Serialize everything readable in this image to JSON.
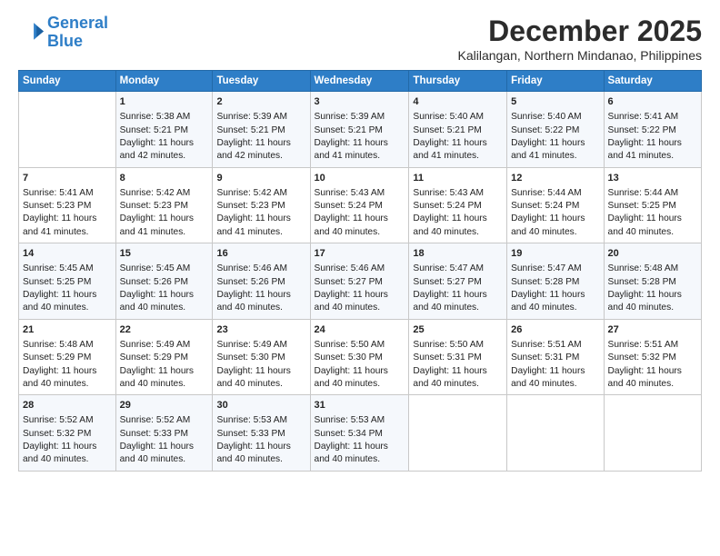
{
  "logo": {
    "line1": "General",
    "line2": "Blue"
  },
  "title": "December 2025",
  "location": "Kalilangan, Northern Mindanao, Philippines",
  "days_header": [
    "Sunday",
    "Monday",
    "Tuesday",
    "Wednesday",
    "Thursday",
    "Friday",
    "Saturday"
  ],
  "weeks": [
    [
      {
        "day": "",
        "sunrise": "",
        "sunset": "",
        "daylight": ""
      },
      {
        "day": "1",
        "sunrise": "Sunrise: 5:38 AM",
        "sunset": "Sunset: 5:21 PM",
        "daylight": "Daylight: 11 hours and 42 minutes."
      },
      {
        "day": "2",
        "sunrise": "Sunrise: 5:39 AM",
        "sunset": "Sunset: 5:21 PM",
        "daylight": "Daylight: 11 hours and 42 minutes."
      },
      {
        "day": "3",
        "sunrise": "Sunrise: 5:39 AM",
        "sunset": "Sunset: 5:21 PM",
        "daylight": "Daylight: 11 hours and 41 minutes."
      },
      {
        "day": "4",
        "sunrise": "Sunrise: 5:40 AM",
        "sunset": "Sunset: 5:21 PM",
        "daylight": "Daylight: 11 hours and 41 minutes."
      },
      {
        "day": "5",
        "sunrise": "Sunrise: 5:40 AM",
        "sunset": "Sunset: 5:22 PM",
        "daylight": "Daylight: 11 hours and 41 minutes."
      },
      {
        "day": "6",
        "sunrise": "Sunrise: 5:41 AM",
        "sunset": "Sunset: 5:22 PM",
        "daylight": "Daylight: 11 hours and 41 minutes."
      }
    ],
    [
      {
        "day": "7",
        "sunrise": "Sunrise: 5:41 AM",
        "sunset": "Sunset: 5:23 PM",
        "daylight": "Daylight: 11 hours and 41 minutes."
      },
      {
        "day": "8",
        "sunrise": "Sunrise: 5:42 AM",
        "sunset": "Sunset: 5:23 PM",
        "daylight": "Daylight: 11 hours and 41 minutes."
      },
      {
        "day": "9",
        "sunrise": "Sunrise: 5:42 AM",
        "sunset": "Sunset: 5:23 PM",
        "daylight": "Daylight: 11 hours and 41 minutes."
      },
      {
        "day": "10",
        "sunrise": "Sunrise: 5:43 AM",
        "sunset": "Sunset: 5:24 PM",
        "daylight": "Daylight: 11 hours and 40 minutes."
      },
      {
        "day": "11",
        "sunrise": "Sunrise: 5:43 AM",
        "sunset": "Sunset: 5:24 PM",
        "daylight": "Daylight: 11 hours and 40 minutes."
      },
      {
        "day": "12",
        "sunrise": "Sunrise: 5:44 AM",
        "sunset": "Sunset: 5:24 PM",
        "daylight": "Daylight: 11 hours and 40 minutes."
      },
      {
        "day": "13",
        "sunrise": "Sunrise: 5:44 AM",
        "sunset": "Sunset: 5:25 PM",
        "daylight": "Daylight: 11 hours and 40 minutes."
      }
    ],
    [
      {
        "day": "14",
        "sunrise": "Sunrise: 5:45 AM",
        "sunset": "Sunset: 5:25 PM",
        "daylight": "Daylight: 11 hours and 40 minutes."
      },
      {
        "day": "15",
        "sunrise": "Sunrise: 5:45 AM",
        "sunset": "Sunset: 5:26 PM",
        "daylight": "Daylight: 11 hours and 40 minutes."
      },
      {
        "day": "16",
        "sunrise": "Sunrise: 5:46 AM",
        "sunset": "Sunset: 5:26 PM",
        "daylight": "Daylight: 11 hours and 40 minutes."
      },
      {
        "day": "17",
        "sunrise": "Sunrise: 5:46 AM",
        "sunset": "Sunset: 5:27 PM",
        "daylight": "Daylight: 11 hours and 40 minutes."
      },
      {
        "day": "18",
        "sunrise": "Sunrise: 5:47 AM",
        "sunset": "Sunset: 5:27 PM",
        "daylight": "Daylight: 11 hours and 40 minutes."
      },
      {
        "day": "19",
        "sunrise": "Sunrise: 5:47 AM",
        "sunset": "Sunset: 5:28 PM",
        "daylight": "Daylight: 11 hours and 40 minutes."
      },
      {
        "day": "20",
        "sunrise": "Sunrise: 5:48 AM",
        "sunset": "Sunset: 5:28 PM",
        "daylight": "Daylight: 11 hours and 40 minutes."
      }
    ],
    [
      {
        "day": "21",
        "sunrise": "Sunrise: 5:48 AM",
        "sunset": "Sunset: 5:29 PM",
        "daylight": "Daylight: 11 hours and 40 minutes."
      },
      {
        "day": "22",
        "sunrise": "Sunrise: 5:49 AM",
        "sunset": "Sunset: 5:29 PM",
        "daylight": "Daylight: 11 hours and 40 minutes."
      },
      {
        "day": "23",
        "sunrise": "Sunrise: 5:49 AM",
        "sunset": "Sunset: 5:30 PM",
        "daylight": "Daylight: 11 hours and 40 minutes."
      },
      {
        "day": "24",
        "sunrise": "Sunrise: 5:50 AM",
        "sunset": "Sunset: 5:30 PM",
        "daylight": "Daylight: 11 hours and 40 minutes."
      },
      {
        "day": "25",
        "sunrise": "Sunrise: 5:50 AM",
        "sunset": "Sunset: 5:31 PM",
        "daylight": "Daylight: 11 hours and 40 minutes."
      },
      {
        "day": "26",
        "sunrise": "Sunrise: 5:51 AM",
        "sunset": "Sunset: 5:31 PM",
        "daylight": "Daylight: 11 hours and 40 minutes."
      },
      {
        "day": "27",
        "sunrise": "Sunrise: 5:51 AM",
        "sunset": "Sunset: 5:32 PM",
        "daylight": "Daylight: 11 hours and 40 minutes."
      }
    ],
    [
      {
        "day": "28",
        "sunrise": "Sunrise: 5:52 AM",
        "sunset": "Sunset: 5:32 PM",
        "daylight": "Daylight: 11 hours and 40 minutes."
      },
      {
        "day": "29",
        "sunrise": "Sunrise: 5:52 AM",
        "sunset": "Sunset: 5:33 PM",
        "daylight": "Daylight: 11 hours and 40 minutes."
      },
      {
        "day": "30",
        "sunrise": "Sunrise: 5:53 AM",
        "sunset": "Sunset: 5:33 PM",
        "daylight": "Daylight: 11 hours and 40 minutes."
      },
      {
        "day": "31",
        "sunrise": "Sunrise: 5:53 AM",
        "sunset": "Sunset: 5:34 PM",
        "daylight": "Daylight: 11 hours and 40 minutes."
      },
      {
        "day": "",
        "sunrise": "",
        "sunset": "",
        "daylight": ""
      },
      {
        "day": "",
        "sunrise": "",
        "sunset": "",
        "daylight": ""
      },
      {
        "day": "",
        "sunrise": "",
        "sunset": "",
        "daylight": ""
      }
    ]
  ]
}
